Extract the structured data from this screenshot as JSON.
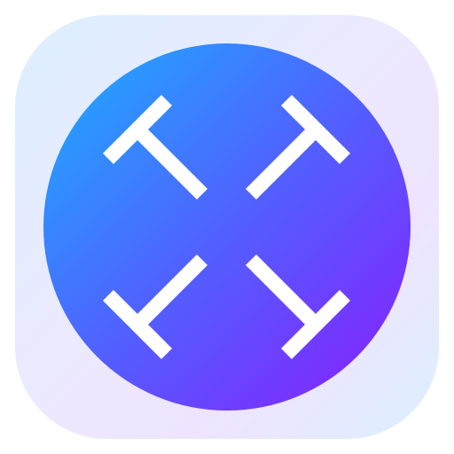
{
  "app_icon": {
    "name": "expand-arrows-icon",
    "colors": {
      "tile_light_blue": "#dcefff",
      "tile_light_purple": "#efe4ff",
      "circle_blue": "#1ab0ff",
      "circle_mid": "#4f63ff",
      "circle_purple": "#8a1cff",
      "glyph": "#ffffff"
    }
  }
}
